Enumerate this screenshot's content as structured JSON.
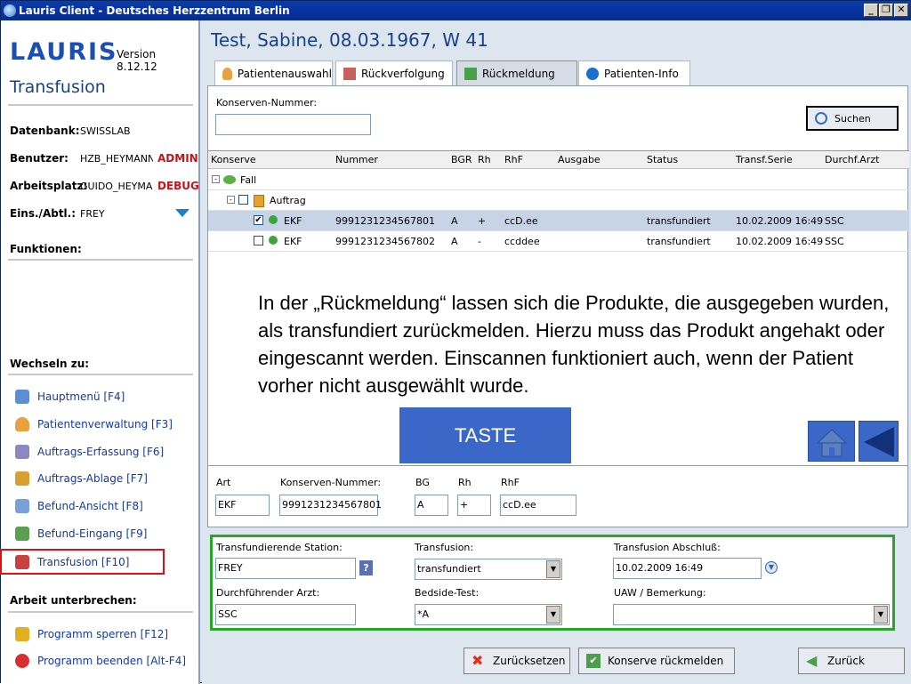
{
  "window": {
    "title": "Lauris Client - Deutsches Herzzentrum Berlin"
  },
  "sidebar": {
    "logo": "LAURIS",
    "version": "Version 8.12.12",
    "section_title": "Transfusion",
    "info": [
      {
        "key": "Datenbank:",
        "value": "SWISSLAB",
        "role": ""
      },
      {
        "key": "Benutzer:",
        "value": "HZB_HEYMANNG",
        "role": "ADMIN"
      },
      {
        "key": "Arbeitsplatz:",
        "value": "GUIDO_HEYMAN",
        "role": "DEBUG"
      },
      {
        "key": "Eins./Abtl.:",
        "value": "FREY",
        "role": ""
      }
    ],
    "functions_label": "Funktionen:",
    "switch_label": "Wechseln zu:",
    "nav": [
      {
        "label": "Hauptmenü [F4]",
        "icon": "home-icon",
        "color": "#5a8fd6"
      },
      {
        "label": "Patientenverwaltung [F3]",
        "icon": "person-icon",
        "color": "#e8a040"
      },
      {
        "label": "Auftrags-Erfassung [F6]",
        "icon": "order-entry-icon",
        "color": "#8a8ac0"
      },
      {
        "label": "Auftrags-Ablage [F7]",
        "icon": "order-archive-icon",
        "color": "#d8a030"
      },
      {
        "label": "Befund-Ansicht [F8]",
        "icon": "report-view-icon",
        "color": "#7aa0d8"
      },
      {
        "label": "Befund-Eingang [F9]",
        "icon": "report-inbox-icon",
        "color": "#5aa050"
      },
      {
        "label": "Transfusion [F10]",
        "icon": "transfusion-icon",
        "color": "#c84040"
      }
    ],
    "pause_label": "Arbeit unterbrechen:",
    "pause_nav": [
      {
        "label": "Programm sperren [F12]",
        "icon": "lock-icon",
        "color": "#e0b020"
      },
      {
        "label": "Programm beenden [Alt-F4]",
        "icon": "power-icon",
        "color": "#d83030"
      }
    ]
  },
  "main": {
    "patient": "Test, Sabine, 08.03.1967, W 41",
    "tabs": [
      {
        "label": "Patientenauswahl",
        "icon": "person-icon"
      },
      {
        "label": "Rückverfolgung",
        "icon": "trace-icon"
      },
      {
        "label": "Rückmeldung",
        "icon": "check-icon"
      },
      {
        "label": "Patienten-Info",
        "icon": "info-icon"
      }
    ],
    "search": {
      "label": "Konserven-Nummer:",
      "value": "",
      "button": "Suchen"
    },
    "grid": {
      "headers": [
        "Konserve",
        "Nummer",
        "BGR",
        "Rh",
        "RhF",
        "Ausgabe",
        "Status",
        "Transf.Serie",
        "Durchf.Arzt"
      ],
      "tree_fall": "Fall",
      "tree_auftrag": "Auftrag",
      "rows": [
        {
          "konserve": "EKF",
          "nummer": "9991231234567801",
          "bgr": "A",
          "rh": "+",
          "rhf": "ccD.ee",
          "ausgabe": "",
          "status": "transfundiert",
          "serie": "10.02.2009 16:49",
          "arzt": "SSC",
          "checked": true
        },
        {
          "konserve": "EKF",
          "nummer": "9991231234567802",
          "bgr": "A",
          "rh": "-",
          "rhf": "ccddee",
          "ausgabe": "",
          "status": "transfundiert",
          "serie": "10.02.2009 16:49",
          "arzt": "SSC",
          "checked": false
        }
      ]
    },
    "overlay": "In der „Rückmeldung“ lassen sich die Produkte, die ausgegeben wurden, als transfundiert zurückmelden. Hierzu muss das Produkt angehakt oder eingescannt werden. Einscannen funktioniert auch, wenn der Patient vorher nicht ausgewählt wurde.",
    "taste": "TASTE",
    "detail": {
      "art_label": "Art",
      "art": "EKF",
      "nr_label": "Konserven-Nummer:",
      "nr": "9991231234567801",
      "bg_label": "BG",
      "bg": "A",
      "rh_label": "Rh",
      "rh": "+",
      "rhf_label": "RhF",
      "rhf": "ccD.ee"
    },
    "form": {
      "station_label": "Transfundierende Station:",
      "station": "FREY",
      "transfusion_label": "Transfusion:",
      "transfusion": "transfundiert",
      "abschluss_label": "Transfusion Abschluß:",
      "abschluss": "10.02.2009 16:49",
      "arzt_label": "Durchführender Arzt:",
      "arzt": "SSC",
      "bedside_label": "Bedside-Test:",
      "bedside": "*A",
      "uaw_label": "UAW / Bemerkung:",
      "uaw": ""
    },
    "buttons": {
      "reset": "Zurücksetzen",
      "submit": "Konserve rückmelden",
      "back": "Zurück"
    }
  }
}
